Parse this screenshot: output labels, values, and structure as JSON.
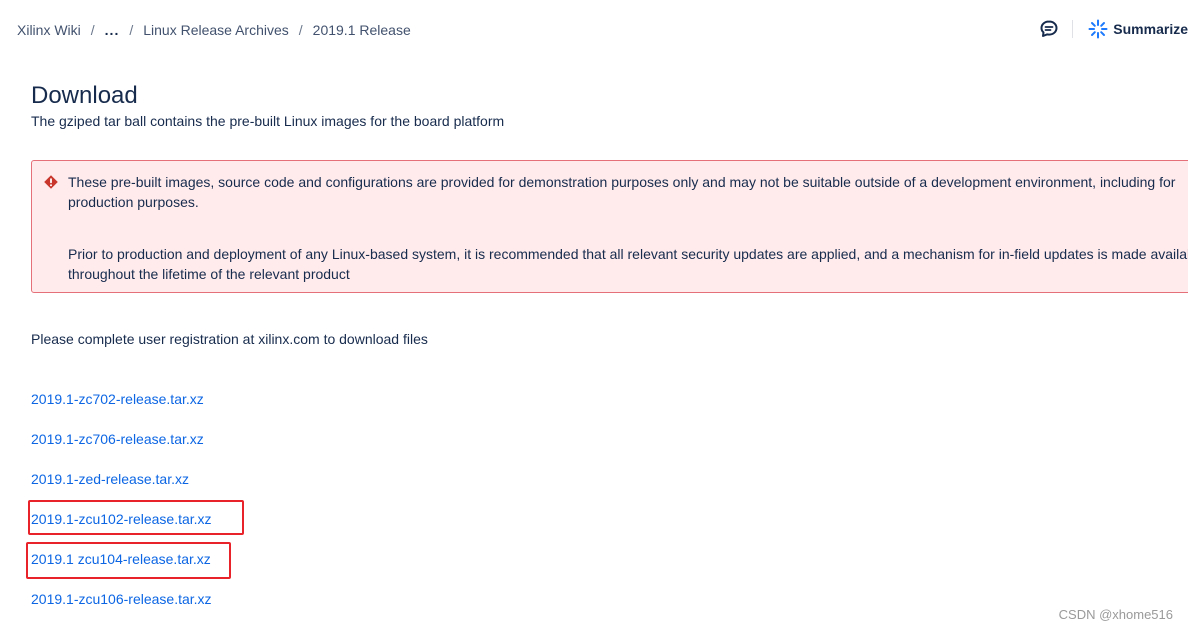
{
  "breadcrumb": {
    "items": [
      "Xilinx Wiki",
      "...",
      "Linux Release Archives",
      "2019.1 Release"
    ],
    "separator": "/"
  },
  "toolbar": {
    "comment_icon": "comment-icon",
    "summarize_icon": "sparkle-icon",
    "summarize_label": "Summarize"
  },
  "page": {
    "title": "Download",
    "subtitle": "The gziped tar ball contains the pre-built Linux images for the board platform"
  },
  "alert": {
    "icon": "warning-icon",
    "color": "#e5707a",
    "background": "#ffebec",
    "paragraph1": "These pre-built images, source code and configurations are provided for demonstration purposes only and may not be suitable outside of a development environment, including for production purposes.",
    "paragraph2": "Prior to production and deployment of any Linux-based system, it is recommended that all relevant security updates are applied, and a mechanism for in-field updates is made available throughout the lifetime of the relevant product"
  },
  "registration_text": "Please complete user registration at xilinx.com to download files",
  "downloads": [
    "2019.1-zc702-release.tar.xz",
    "2019.1-zc706-release.tar.xz",
    "2019.1-zed-release.tar.xz",
    "2019.1-zcu102-release.tar.xz",
    "2019.1 zcu104-release.tar.xz",
    "2019.1-zcu106-release.tar.xz"
  ],
  "highlight_color": "#e8232a",
  "link_color": "#0c66e4",
  "watermark": "CSDN @xhome516"
}
